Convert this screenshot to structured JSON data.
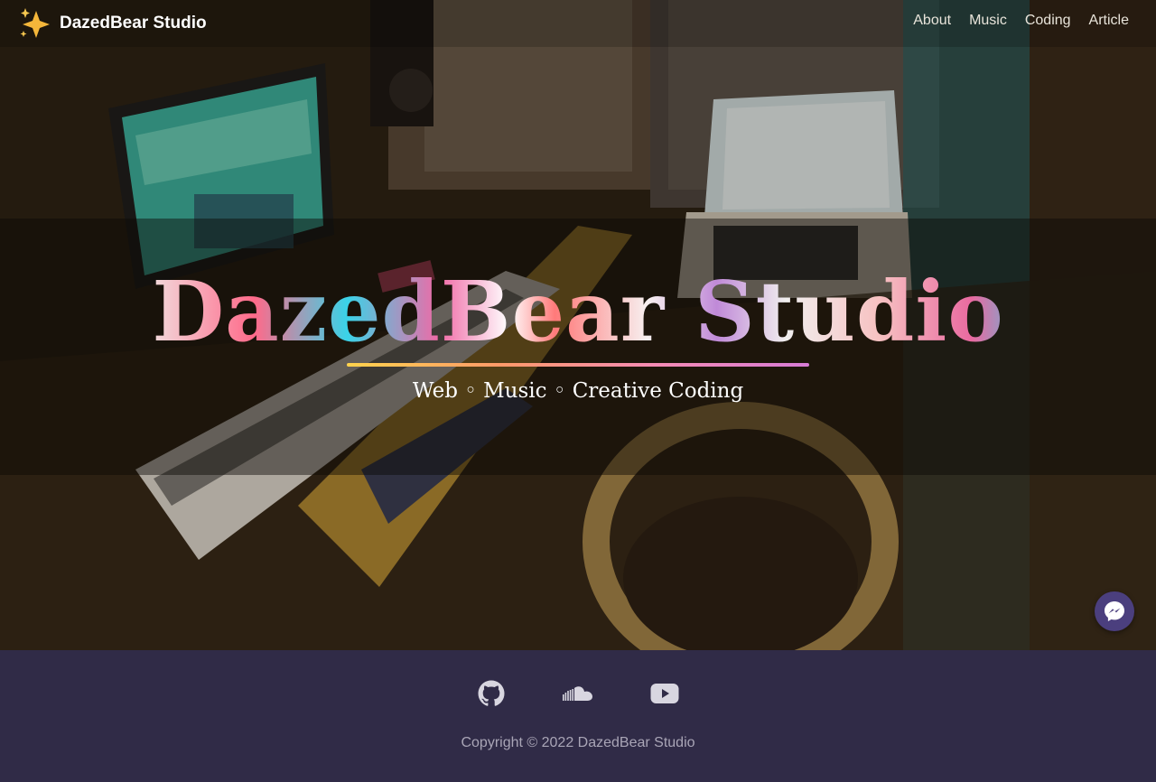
{
  "brand": {
    "name": "DazedBear Studio",
    "icon": "sparkles-icon"
  },
  "nav": {
    "links": [
      {
        "label": "About"
      },
      {
        "label": "Music"
      },
      {
        "label": "Coding"
      },
      {
        "label": "Article"
      }
    ]
  },
  "hero": {
    "title": "DazedBear Studio",
    "subtitle": "Web ◦ Music ◦ Creative Coding"
  },
  "messenger": {
    "icon": "messenger-icon"
  },
  "footer": {
    "social": [
      {
        "icon": "github-icon"
      },
      {
        "icon": "soundcloud-icon"
      },
      {
        "icon": "youtube-icon"
      }
    ],
    "copyright": "Copyright © 2022 DazedBear Studio"
  },
  "colors": {
    "footer_bg": "#302b47",
    "messenger_bg": "#4b3f7e",
    "accent_gradient": [
      "#ffd34d",
      "#f58bb5",
      "#d77bd6"
    ]
  }
}
